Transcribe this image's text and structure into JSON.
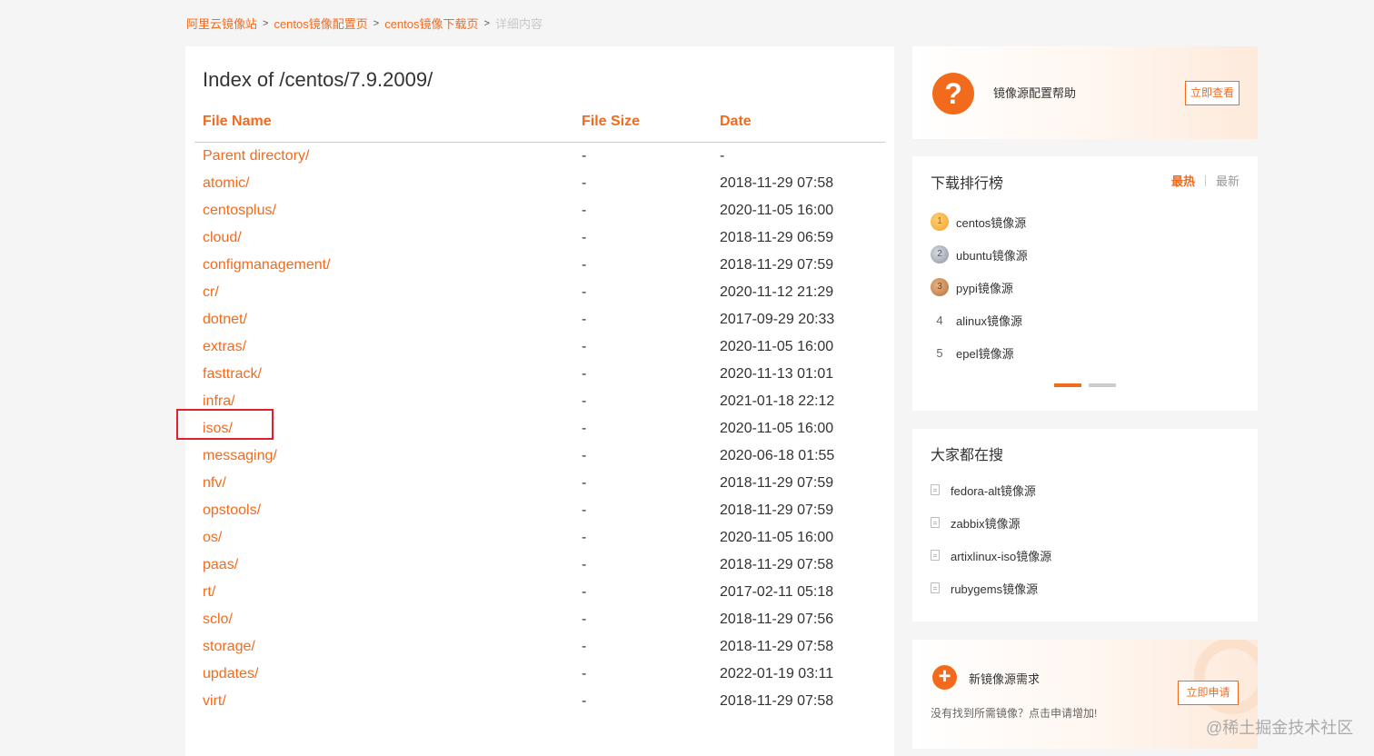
{
  "breadcrumb": {
    "items": [
      "阿里云镜像站",
      "centos镜像配置页",
      "centos镜像下载页"
    ],
    "current": "详细内容",
    "separator": ">"
  },
  "listing": {
    "title": "Index of /centos/7.9.2009/",
    "headers": {
      "name": "File Name",
      "size": "File Size",
      "date": "Date"
    },
    "rows": [
      {
        "name": "Parent directory/",
        "size": "-",
        "date": "-"
      },
      {
        "name": "atomic/",
        "size": "-",
        "date": "2018-11-29 07:58"
      },
      {
        "name": "centosplus/",
        "size": "-",
        "date": "2020-11-05 16:00"
      },
      {
        "name": "cloud/",
        "size": "-",
        "date": "2018-11-29 06:59"
      },
      {
        "name": "configmanagement/",
        "size": "-",
        "date": "2018-11-29 07:59"
      },
      {
        "name": "cr/",
        "size": "-",
        "date": "2020-11-12 21:29"
      },
      {
        "name": "dotnet/",
        "size": "-",
        "date": "2017-09-29 20:33"
      },
      {
        "name": "extras/",
        "size": "-",
        "date": "2020-11-05 16:00"
      },
      {
        "name": "fasttrack/",
        "size": "-",
        "date": "2020-11-13 01:01"
      },
      {
        "name": "infra/",
        "size": "-",
        "date": "2021-01-18 22:12"
      },
      {
        "name": "isos/",
        "size": "-",
        "date": "2020-11-05 16:00"
      },
      {
        "name": "messaging/",
        "size": "-",
        "date": "2020-06-18 01:55"
      },
      {
        "name": "nfv/",
        "size": "-",
        "date": "2018-11-29 07:59"
      },
      {
        "name": "opstools/",
        "size": "-",
        "date": "2018-11-29 07:59"
      },
      {
        "name": "os/",
        "size": "-",
        "date": "2020-11-05 16:00"
      },
      {
        "name": "paas/",
        "size": "-",
        "date": "2018-11-29 07:58"
      },
      {
        "name": "rt/",
        "size": "-",
        "date": "2017-02-11 05:18"
      },
      {
        "name": "sclo/",
        "size": "-",
        "date": "2018-11-29 07:56"
      },
      {
        "name": "storage/",
        "size": "-",
        "date": "2018-11-29 07:58"
      },
      {
        "name": "updates/",
        "size": "-",
        "date": "2022-01-19 03:11"
      },
      {
        "name": "virt/",
        "size": "-",
        "date": "2018-11-29 07:58"
      }
    ]
  },
  "help": {
    "icon": "question-icon",
    "title": "镜像源配置帮助",
    "button": "立即查看"
  },
  "rank": {
    "title": "下载排行榜",
    "tab_hot": "最热",
    "tab_new": "最新",
    "items": [
      {
        "num": "1",
        "name": "centos镜像源"
      },
      {
        "num": "2",
        "name": "ubuntu镜像源"
      },
      {
        "num": "3",
        "name": "pypi镜像源"
      },
      {
        "num": "4",
        "name": "alinux镜像源"
      },
      {
        "num": "5",
        "name": "epel镜像源"
      }
    ]
  },
  "search": {
    "title": "大家都在搜",
    "items": [
      "fedora-alt镜像源",
      "zabbix镜像源",
      "artixlinux-iso镜像源",
      "rubygems镜像源"
    ]
  },
  "request": {
    "icon": "plus-icon",
    "title": "新镜像源需求",
    "subtitle": "没有找到所需镜像？点击申请增加!",
    "button": "立即申请"
  },
  "watermark": "@稀土掘金技术社区",
  "colors": {
    "accent": "#f26b1d",
    "highlight": "#e0202f"
  }
}
